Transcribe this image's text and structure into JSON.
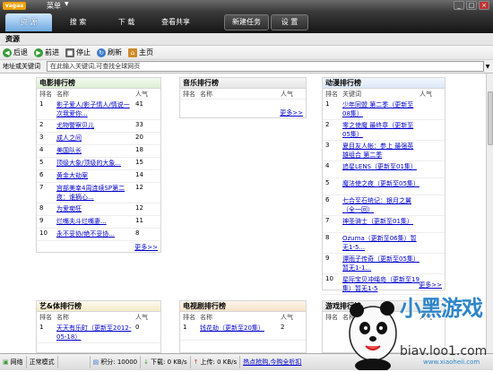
{
  "titlebar": {
    "logo": "vagaa",
    "menu": "菜单",
    "min": "_",
    "max": "□",
    "close": "×"
  },
  "tabs": [
    {
      "label": "资 源",
      "active": true
    },
    {
      "label": "搜 索"
    },
    {
      "label": "下 载"
    },
    {
      "label": "查看共享"
    },
    {
      "label": "新建任务"
    },
    {
      "label": "设 置"
    }
  ],
  "section_title": "资源",
  "nav": {
    "back": "后退",
    "forward": "前进",
    "stop": "停止",
    "refresh": "刷新",
    "home": "主页"
  },
  "address": {
    "label": "地址或关键词",
    "value": "在此输入关键词,可查找全球网页"
  },
  "movie": {
    "title": "电影排行榜",
    "h_rank": "排名",
    "h_name": "名称",
    "h_pop": "人气",
    "rows": [
      {
        "rank": "1",
        "name": "影子爱人/影子情人/情说一次我爱你...",
        "pop": "41"
      },
      {
        "rank": "2",
        "name": "尤物警察贝儿",
        "pop": "33"
      },
      {
        "rank": "3",
        "name": "成人之间",
        "pop": "20"
      },
      {
        "rank": "4",
        "name": "美国队长",
        "pop": "18"
      },
      {
        "rank": "5",
        "name": "顶级大象/顶级的大象...",
        "pop": "15"
      },
      {
        "rank": "6",
        "name": "黄金大劫案",
        "pop": "14"
      },
      {
        "rank": "7",
        "name": "宫部美幸4周连续SP第二夜：谁摘心...",
        "pop": "12"
      },
      {
        "rank": "8",
        "name": "为爱痴狂",
        "pop": "12"
      },
      {
        "rank": "9",
        "name": "烂嘴夫斗烂嘴妻...",
        "pop": "11"
      },
      {
        "rank": "10",
        "name": "永不妥协/绝不妥协...",
        "pop": "8"
      }
    ],
    "more": "更多>>"
  },
  "music": {
    "title": "音乐排行榜",
    "h_rank": "排名",
    "h_name": "名称",
    "h_pop": "人气",
    "more": "更多>>"
  },
  "anime": {
    "title": "动漫排行榜",
    "h_rank": "排名",
    "h_name": "关键词",
    "h_pop": "人气",
    "rows": [
      {
        "rank": "1",
        "name": "少年同盟 第二季（更新至08集）",
        "pop": ""
      },
      {
        "rank": "2",
        "name": "零之使魔 最终章（更新至05集）",
        "pop": ""
      },
      {
        "rank": "3",
        "name": "夏目友人帐：参上 最强英雄组合 第二季",
        "pop": ""
      },
      {
        "rank": "4",
        "name": "追星LENS（更新至01集）",
        "pop": ""
      },
      {
        "rank": "5",
        "name": "魔法使之夜（更新至05集）",
        "pop": ""
      },
      {
        "rank": "6",
        "name": "七合至石统记：银月之翼（全一回）",
        "pop": ""
      },
      {
        "rank": "7",
        "name": "神圣骑士（更新至01集）",
        "pop": ""
      },
      {
        "rank": "8",
        "name": "Ozuma（更新至06集）暂无1-5...",
        "pop": ""
      },
      {
        "rank": "9",
        "name": "谭雨子传奇（更新至05集）暂无1-1...",
        "pop": ""
      },
      {
        "rank": "10",
        "name": "星际宝贝冲绳岛（更新至19集）暂无1-5",
        "pop": ""
      }
    ],
    "more": "更多>>"
  },
  "variety": {
    "title": "艺&体排行榜",
    "h_rank": "排名",
    "h_name": "名称",
    "h_pop": "人气",
    "rows": [
      {
        "rank": "1",
        "name": "天天有乐町（更新至2012-05-18）",
        "pop": "0"
      }
    ]
  },
  "tv": {
    "title": "电视剧排行榜",
    "h_rank": "排名",
    "h_name": "名称",
    "h_pop": "人气",
    "rows": [
      {
        "rank": "1",
        "name": "钱花劫（更新至20集）",
        "pop": "2"
      }
    ]
  },
  "game": {
    "title": "游戏排行榜",
    "h_rank": "排名",
    "h_name": "名称",
    "h_pop": "人气"
  },
  "status": {
    "network": "网络",
    "mode": "正常模式",
    "points": "积分: 10000",
    "down": "下载: 0 KB/s",
    "up": "上传: 0 KB/s",
    "link": "热点抢购,今购全析扣"
  },
  "watermark": {
    "brand": "小黑游戏",
    "url": "www.xiaoheii.com",
    "short": "biav.loo1.com"
  },
  "colors": {
    "accent": "#6fa8e0",
    "link": "#0000cc",
    "titlebar": "#3a3a3a"
  }
}
